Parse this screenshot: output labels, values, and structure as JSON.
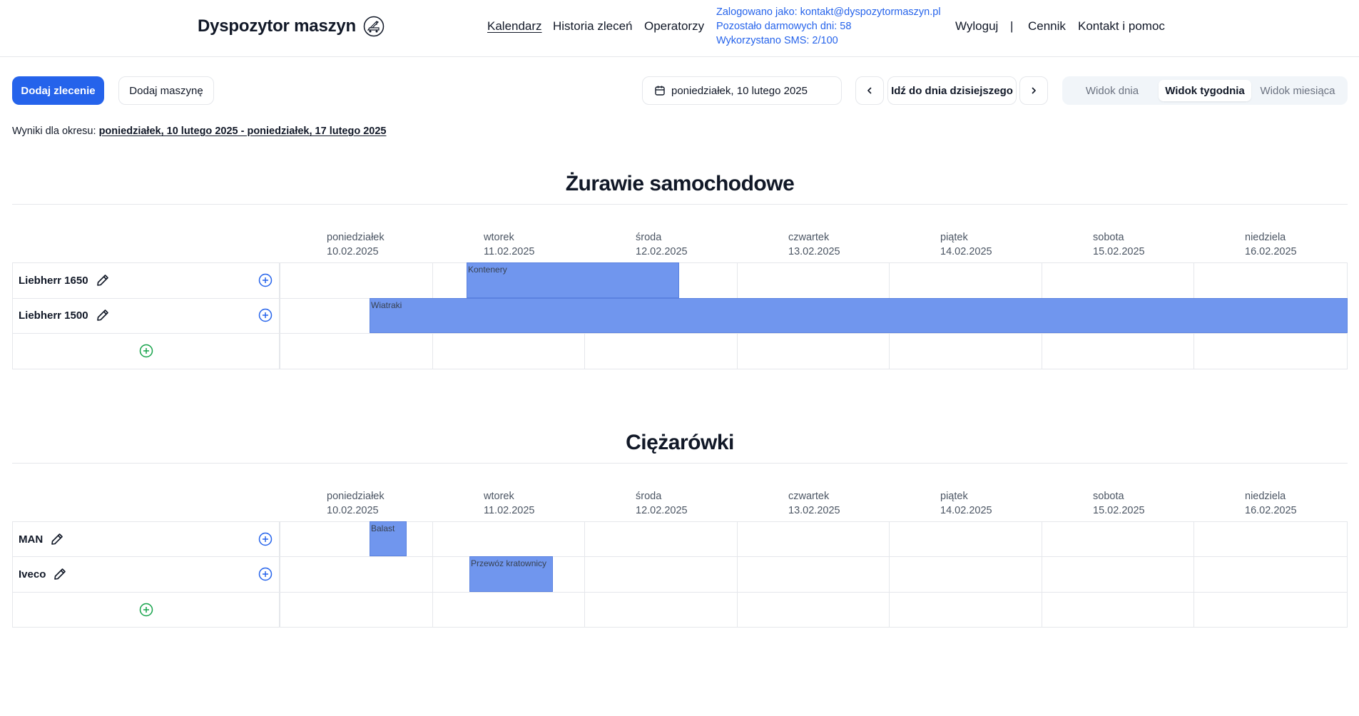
{
  "header": {
    "brand": "Dyspozytor maszyn",
    "nav": {
      "calendar": "Kalendarz",
      "history": "Historia zleceń",
      "operators": "Operatorzy"
    },
    "user": {
      "logged_in": "Zalogowano jako: kontakt@dyspozytormaszyn.pl",
      "free_days": "Pozostało darmowych dni: 58",
      "sms": "Wykorzystano SMS: 2/100"
    },
    "logout": "Wyloguj",
    "separator": "|",
    "pricing": "Cennik",
    "contact": "Kontakt i pomoc"
  },
  "toolbar": {
    "add_order": "Dodaj zlecenie",
    "add_machine": "Dodaj maszynę",
    "date": "poniedziałek, 10 lutego 2025",
    "today": "Idź do dnia dzisiejszego",
    "views": {
      "day": "Widok dnia",
      "week": "Widok tygodnia",
      "month": "Widok miesiąca"
    }
  },
  "period": {
    "label": "Wyniki dla okresu:",
    "range": "poniedziałek, 10 lutego 2025 - poniedziałek, 17 lutego 2025"
  },
  "days": [
    {
      "name": "poniedziałek",
      "date": "10.02.2025"
    },
    {
      "name": "wtorek",
      "date": "11.02.2025"
    },
    {
      "name": "środa",
      "date": "12.02.2025"
    },
    {
      "name": "czwartek",
      "date": "13.02.2025"
    },
    {
      "name": "piątek",
      "date": "14.02.2025"
    },
    {
      "name": "sobota",
      "date": "15.02.2025"
    },
    {
      "name": "niedziela",
      "date": "16.02.2025"
    }
  ],
  "sections": [
    {
      "title": "Żurawie samochodowe",
      "machines": [
        {
          "name": "Liebherr 1650",
          "booking": "Kontenery"
        },
        {
          "name": "Liebherr 1500",
          "booking": "Wiatraki"
        }
      ]
    },
    {
      "title": "Ciężarówki",
      "machines": [
        {
          "name": "MAN",
          "booking": "Balast"
        },
        {
          "name": "Iveco",
          "booking": "Przewóz kratownicy"
        }
      ]
    }
  ],
  "colors": {
    "primary": "#2563eb",
    "booking": "#7096ee",
    "add_machine": "#16a34a"
  }
}
